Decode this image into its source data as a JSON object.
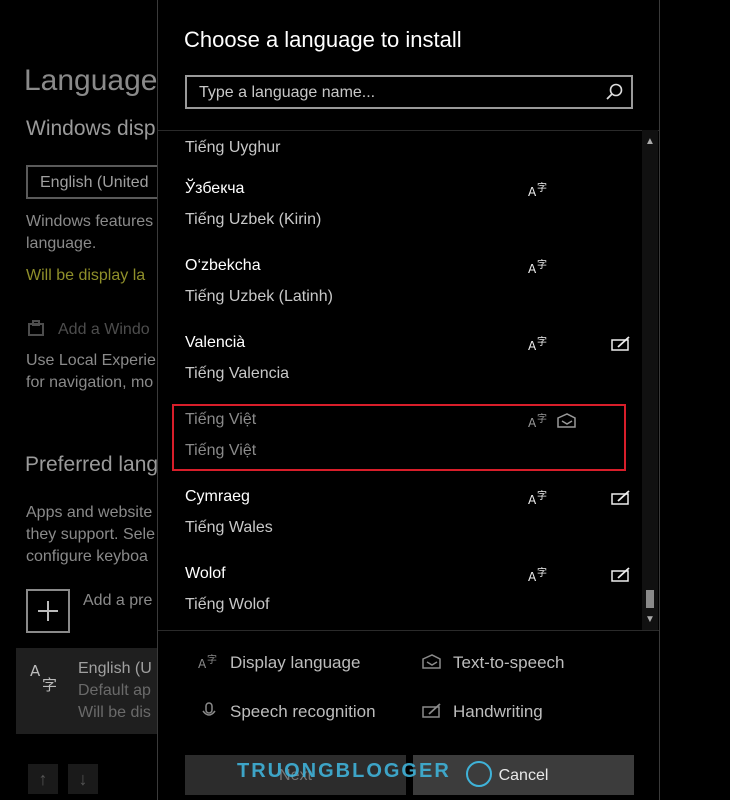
{
  "background": {
    "title": "Language",
    "windows_display_label": "Windows disp",
    "dropdown_value": "English (United",
    "features_line1": "Windows features",
    "features_line2": "language.",
    "will_display": "Will be display la",
    "add_windows": "Add a Windo",
    "local_exp1": "Use Local Experie",
    "local_exp2": "for navigation, mo",
    "preferred_heading": "Preferred lang",
    "apps_line1": "Apps and website",
    "apps_line2": "they support. Sele",
    "apps_line3": "configure keyboa",
    "add_pref": "Add a pre",
    "lang_item_name": "English (U",
    "lang_item_sub1": "Default ap",
    "lang_item_sub2": "Will be dis"
  },
  "dialog": {
    "title": "Choose a language to install",
    "search_placeholder": "Type a language name...",
    "languages": [
      {
        "native": "",
        "localized": "Tiếng Uyghur",
        "display": false,
        "speech": false,
        "handwriting": false,
        "partial": true
      },
      {
        "native": "Ўзбекча",
        "localized": "Tiếng Uzbek (Kirin)",
        "display": true,
        "speech": false,
        "handwriting": false
      },
      {
        "native": "O‘zbekcha",
        "localized": "Tiếng Uzbek (Latinh)",
        "display": true,
        "speech": false,
        "handwriting": false
      },
      {
        "native": "Valencià",
        "localized": "Tiếng Valencia",
        "display": true,
        "speech": false,
        "handwriting": true
      },
      {
        "native": "Tiếng Việt",
        "localized": "Tiếng Việt",
        "display": true,
        "speech": true,
        "handwriting": false,
        "disabled": true
      },
      {
        "native": "Cymraeg",
        "localized": "Tiếng Wales",
        "display": true,
        "speech": false,
        "handwriting": true
      },
      {
        "native": "Wolof",
        "localized": "Tiếng Wolof",
        "display": true,
        "speech": false,
        "handwriting": true
      }
    ],
    "legend": {
      "display_language": "Display language",
      "text_to_speech": "Text-to-speech",
      "speech_recognition": "Speech recognition",
      "handwriting": "Handwriting"
    },
    "buttons": {
      "install": "Next",
      "cancel": "Cancel"
    }
  },
  "watermark": "TRUONGBLOGGER",
  "colors": {
    "highlight": "#d81e2a",
    "watermark": "#3fb2d8",
    "background": "#000000"
  }
}
